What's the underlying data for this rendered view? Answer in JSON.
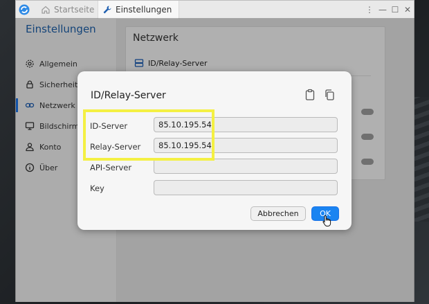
{
  "titlebar": {
    "tabs": [
      {
        "label": "Startseite",
        "icon": "home-icon",
        "active": false
      },
      {
        "label": "Einstellungen",
        "icon": "wrench-icon",
        "active": true
      }
    ],
    "controls": {
      "menu": "⋮",
      "minimize": "—",
      "maximize": "☐",
      "close": "✕"
    }
  },
  "sidebar": {
    "title": "Einstellungen",
    "items": [
      {
        "label": "Allgemein",
        "icon": "gear-icon"
      },
      {
        "label": "Sicherheit",
        "icon": "lock-icon"
      },
      {
        "label": "Netzwerk",
        "icon": "link-icon",
        "active": true
      },
      {
        "label": "Bildschirm",
        "icon": "monitor-icon"
      },
      {
        "label": "Konto",
        "icon": "user-icon"
      },
      {
        "label": "Über",
        "icon": "info-icon"
      }
    ]
  },
  "main": {
    "panel_title": "Netzwerk",
    "row_label": "ID/Relay-Server"
  },
  "dialog": {
    "title": "ID/Relay-Server",
    "fields": [
      {
        "label": "ID-Server",
        "value": "85.10.195.54"
      },
      {
        "label": "Relay-Server",
        "value": "85.10.195.54"
      },
      {
        "label": "API-Server",
        "value": ""
      },
      {
        "label": "Key",
        "value": ""
      }
    ],
    "cancel_label": "Abbrechen",
    "ok_label": "OK"
  },
  "colors": {
    "accent": "#1a84f1",
    "sidebar_title": "#1d5fa8",
    "highlight": "#f4f043"
  }
}
